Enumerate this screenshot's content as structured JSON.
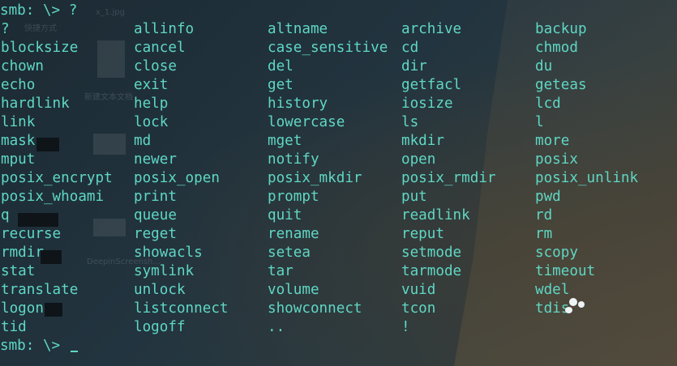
{
  "prompt_line": "smb: \\> ?",
  "final_prompt": "smb: \\> ",
  "desktop_labels": [
    "快捷方式",
    "x_1.jpg",
    "新建文本文档",
    "DeepinScreensh..."
  ],
  "commands": [
    [
      "?",
      "allinfo",
      "altname",
      "archive",
      "backup"
    ],
    [
      "blocksize",
      "cancel",
      "case_sensitive",
      "cd",
      "chmod"
    ],
    [
      "chown",
      "close",
      "del",
      "dir",
      "du"
    ],
    [
      "echo",
      "exit",
      "get",
      "getfacl",
      "geteas"
    ],
    [
      "hardlink",
      "help",
      "history",
      "iosize",
      "lcd"
    ],
    [
      "link",
      "lock",
      "lowercase",
      "ls",
      "l"
    ],
    [
      "mask",
      "md",
      "mget",
      "mkdir",
      "more"
    ],
    [
      "mput",
      "newer",
      "notify",
      "open",
      "posix"
    ],
    [
      "posix_encrypt",
      "posix_open",
      "posix_mkdir",
      "posix_rmdir",
      "posix_unlink"
    ],
    [
      "posix_whoami",
      "print",
      "prompt",
      "put",
      "pwd"
    ],
    [
      "q",
      "queue",
      "quit",
      "readlink",
      "rd"
    ],
    [
      "recurse",
      "reget",
      "rename",
      "reput",
      "rm"
    ],
    [
      "rmdir",
      "showacls",
      "setea",
      "setmode",
      "scopy"
    ],
    [
      "stat",
      "symlink",
      "tar",
      "tarmode",
      "timeout"
    ],
    [
      "translate",
      "unlock",
      "volume",
      "vuid",
      "wdel"
    ],
    [
      "logon",
      "listconnect",
      "showconnect",
      "tcon",
      "tdis"
    ],
    [
      "tid",
      "logoff",
      "..",
      "!",
      ""
    ]
  ],
  "colors": {
    "text": "#5fd7c4",
    "background": "#1f2f38"
  }
}
